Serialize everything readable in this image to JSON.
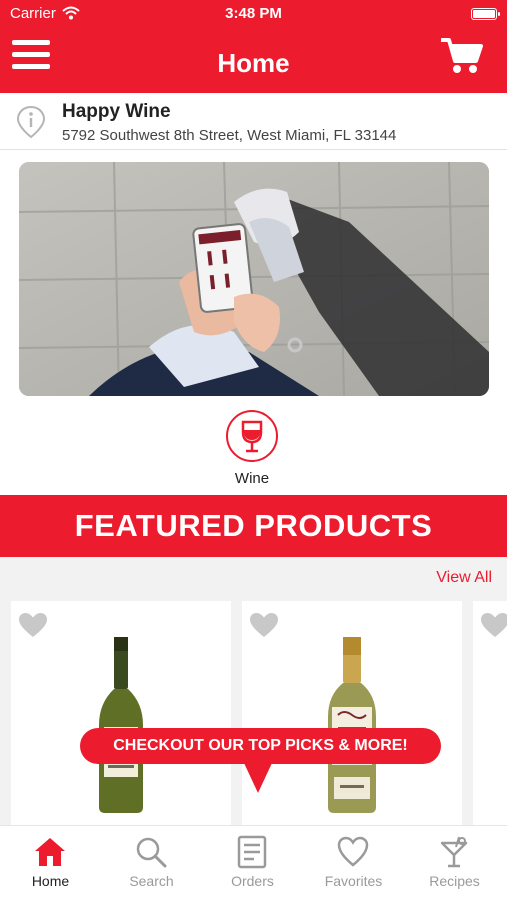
{
  "status_bar": {
    "carrier": "Carrier",
    "time": "3:48 PM"
  },
  "header": {
    "title": "Home",
    "menu_icon": "hamburger-menu-icon",
    "cart_icon": "shopping-cart-icon"
  },
  "store": {
    "name": "Happy Wine",
    "address": "5792 Southwest 8th Street, West Miami, FL 33144",
    "icon": "location-info-icon"
  },
  "categories": [
    {
      "label": "Wine",
      "icon": "wine-glass-icon"
    }
  ],
  "featured": {
    "title": "FEATURED PRODUCTS",
    "view_all": "View All",
    "promo": "CHECKOUT OUR TOP PICKS & MORE!"
  },
  "tabs": [
    {
      "label": "Home",
      "icon": "home-icon",
      "active": true
    },
    {
      "label": "Search",
      "icon": "search-icon",
      "active": false
    },
    {
      "label": "Orders",
      "icon": "orders-icon",
      "active": false
    },
    {
      "label": "Favorites",
      "icon": "heart-icon",
      "active": false
    },
    {
      "label": "Recipes",
      "icon": "cocktail-icon",
      "active": false
    }
  ],
  "colors": {
    "brand": "#ec1c2e",
    "tab_inactive": "#9a9a9a",
    "heart": "#c8c8c8",
    "product_bg": "#f2f2f2"
  }
}
